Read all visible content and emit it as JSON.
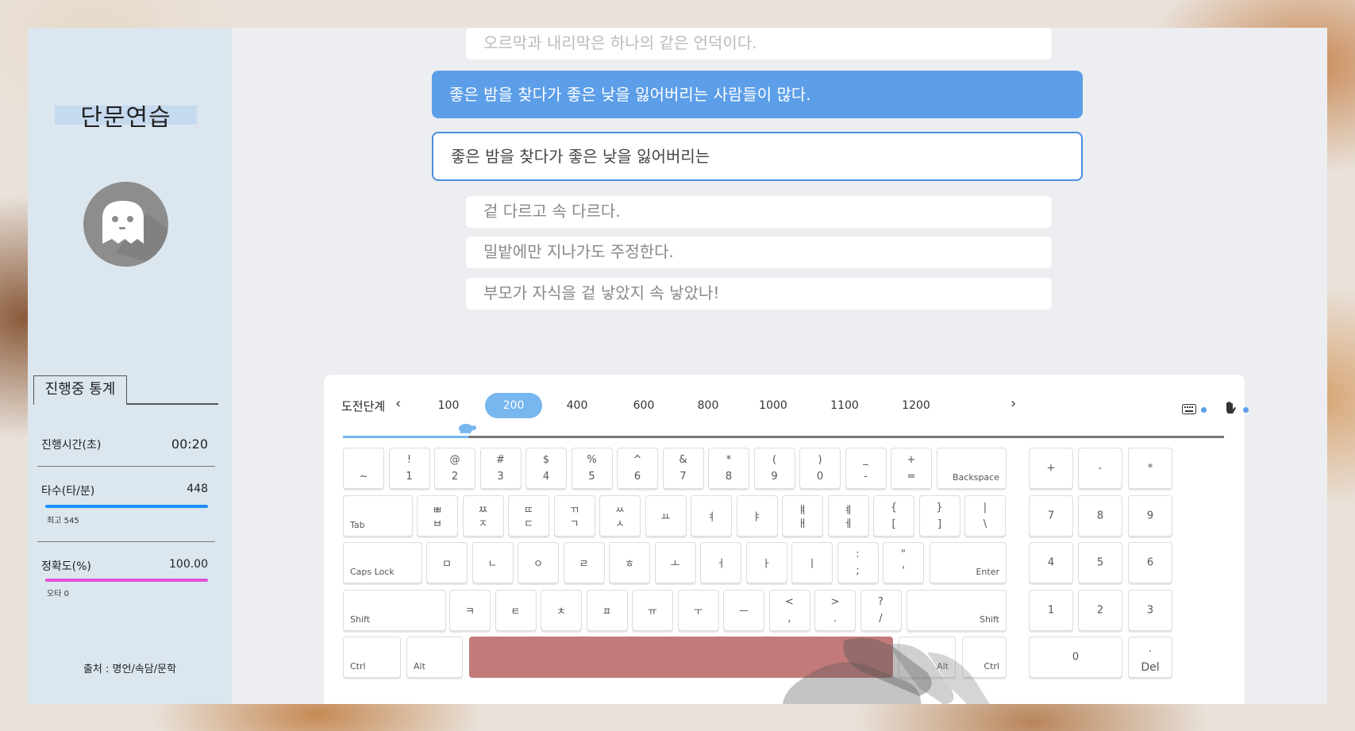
{
  "sidebar": {
    "title": "단문연습",
    "stats_tab": "진행중 통계",
    "elapsed_label": "진행시간(초)",
    "elapsed_value": "00:20",
    "speed_label": "타수(타/분)",
    "speed_value": "448",
    "speed_best": "최고 545",
    "accuracy_label": "정확도(%)",
    "accuracy_value": "100.00",
    "typo": "오타 0",
    "source": "출처 : 명언/속담/문학",
    "colors": {
      "speed_bar": "#1e90ff",
      "accuracy_bar": "#e24fd6"
    }
  },
  "sentences": {
    "previous": "오르막과 내리막은 하나의 같은 언덕이다.",
    "current": "좋은 밤을 찾다가 좋은 낮을 잃어버리는 사람들이 많다.",
    "typed": "좋은 밤을 찾다가 좋은 낮을 잃어버리는",
    "upcoming": [
      "겉 다르고 속 다르다.",
      "밀밭에만 지나가도 주정한다.",
      "부모가 자식을 겉 낳았지 속 낳았나!"
    ]
  },
  "levels": {
    "label": "도전단계",
    "prev_icon": "‹",
    "next_icon": "›",
    "items": [
      "100",
      "200",
      "400",
      "600",
      "800",
      "1000",
      "1100",
      "1200"
    ],
    "selected": "200",
    "progress": 0.14,
    "progress_color": "#78b6ef",
    "keyboard_icon": "keyboard-icon",
    "hand_icon": "hand-icon"
  },
  "keyboard": {
    "row1": [
      {
        "t": "",
        "b": "~"
      },
      {
        "t": "!",
        "b": "1"
      },
      {
        "t": "@",
        "b": "2"
      },
      {
        "t": "#",
        "b": "3"
      },
      {
        "t": "$",
        "b": "4"
      },
      {
        "t": "%",
        "b": "5"
      },
      {
        "t": "^",
        "b": "6"
      },
      {
        "t": "&",
        "b": "7"
      },
      {
        "t": "*",
        "b": "8"
      },
      {
        "t": "(",
        "b": "9"
      },
      {
        "t": ")",
        "b": "0"
      },
      {
        "t": "_",
        "b": "-"
      },
      {
        "t": "+",
        "b": "="
      }
    ],
    "backspace": "Backspace",
    "tab": "Tab",
    "row2": [
      {
        "t": "ㅃ",
        "b": "ㅂ"
      },
      {
        "t": "ㅉ",
        "b": "ㅈ"
      },
      {
        "t": "ㄸ",
        "b": "ㄷ"
      },
      {
        "t": "ㄲ",
        "b": "ㄱ"
      },
      {
        "t": "ㅆ",
        "b": "ㅅ"
      },
      {
        "c": "ㅛ"
      },
      {
        "c": "ㅕ"
      },
      {
        "c": "ㅑ"
      },
      {
        "t": "ㅒ",
        "b": "ㅐ"
      },
      {
        "t": "ㅖ",
        "b": "ㅔ"
      },
      {
        "t": "{",
        "b": "["
      },
      {
        "t": "}",
        "b": "]"
      },
      {
        "t": "|",
        "b": "\\"
      }
    ],
    "capslock": "Caps Lock",
    "row3": [
      {
        "c": "ㅁ"
      },
      {
        "c": "ㄴ"
      },
      {
        "c": "ㅇ"
      },
      {
        "c": "ㄹ"
      },
      {
        "c": "ㅎ"
      },
      {
        "c": "ㅗ"
      },
      {
        "c": "ㅓ"
      },
      {
        "c": "ㅏ"
      },
      {
        "c": "ㅣ"
      },
      {
        "t": ":",
        "b": ";"
      },
      {
        "t": "\"",
        "b": "'"
      }
    ],
    "enter": "Enter",
    "shift_left": "Shift",
    "row4": [
      {
        "c": "ㅋ"
      },
      {
        "c": "ㅌ"
      },
      {
        "c": "ㅊ"
      },
      {
        "c": "ㅍ"
      },
      {
        "c": "ㅠ"
      },
      {
        "c": "ㅜ"
      },
      {
        "c": "ㅡ"
      },
      {
        "t": "<",
        "b": ","
      },
      {
        "t": ">",
        "b": "."
      },
      {
        "t": "?",
        "b": "/"
      }
    ],
    "shift_right": "Shift",
    "ctrl_left": "Ctrl",
    "alt_left": "Alt",
    "alt_right": "Alt",
    "ctrl_right": "Ctrl",
    "space_color": "#c27a7a",
    "numpad": {
      "row1": [
        "+",
        "-",
        "*"
      ],
      "row2": [
        "7",
        "8",
        "9"
      ],
      "row3": [
        "4",
        "5",
        "6"
      ],
      "row4": [
        "1",
        "2",
        "3"
      ],
      "zero": "0",
      "dot": ".",
      "del": "Del"
    }
  }
}
